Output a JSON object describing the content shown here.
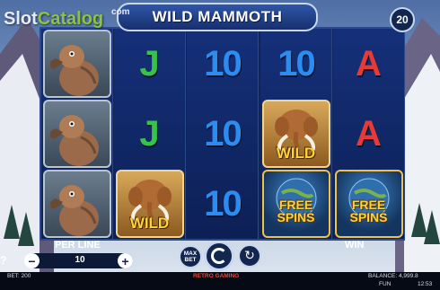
{
  "watermark": {
    "brand_part1": "Slot",
    "brand_part2": "Catalog",
    "brand_suffix": "com"
  },
  "game": {
    "title": "WILD MAMMOTH",
    "lines": "20"
  },
  "reels": [
    [
      {
        "type": "symbol",
        "symbol": "dodo-bird"
      },
      {
        "type": "symbol",
        "symbol": "dodo-bird"
      },
      {
        "type": "symbol",
        "symbol": "dodo-bird"
      }
    ],
    [
      {
        "type": "letter",
        "text": "J",
        "cls": "j"
      },
      {
        "type": "letter",
        "text": "J",
        "cls": "j"
      },
      {
        "type": "wild",
        "text": "WILD"
      }
    ],
    [
      {
        "type": "letter",
        "text": "10",
        "cls": "ten"
      },
      {
        "type": "letter",
        "text": "10",
        "cls": "ten"
      },
      {
        "type": "letter",
        "text": "10",
        "cls": "ten"
      }
    ],
    [
      {
        "type": "letter",
        "text": "10",
        "cls": "ten"
      },
      {
        "type": "wild",
        "text": "WILD"
      },
      {
        "type": "free",
        "line1": "FREE",
        "line2": "SPINS"
      }
    ],
    [
      {
        "type": "letter",
        "text": "A",
        "cls": "ace"
      },
      {
        "type": "letter",
        "text": "A",
        "cls": "ace"
      },
      {
        "type": "free",
        "line1": "FREE",
        "line2": "SPINS"
      }
    ]
  ],
  "controls": {
    "per_line_label": "PER LINE",
    "bet_value": "10",
    "minus_label": "−",
    "plus_label": "+",
    "max_bet_line1": "MAX",
    "max_bet_line2": "BET",
    "win_label": "WIN",
    "help_label": "?"
  },
  "status": {
    "bet": "BET: 200",
    "provider": "RETRO GAMING",
    "balance": "BALANCE: 4,999.8",
    "mode": "FUN",
    "time": "12:53"
  }
}
